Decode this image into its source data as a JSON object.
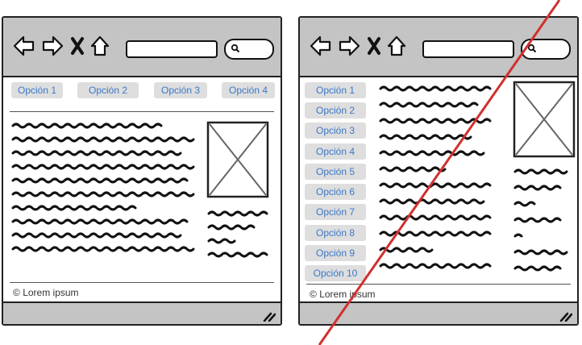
{
  "mockup_a": {
    "tabs": [
      "Opción 1",
      "Opción 2",
      "Opción 3",
      "Opción 4"
    ],
    "footer": "Lorem ipsum",
    "copyright_symbol": "©"
  },
  "mockup_b": {
    "sidebar_items": [
      "Opción 1",
      "Opción 2",
      "Opción 3",
      "Opción 4",
      "Opción 5",
      "Opción 6",
      "Opción 7",
      "Opción 8",
      "Opción 9",
      "Opción 10"
    ],
    "footer": "Lorem ipsum",
    "copyright_symbol": "©",
    "crossed_out": true
  },
  "colors": {
    "toolbar": "#c4c4c4",
    "tab_bg": "#dedede",
    "link": "#3a78c8",
    "strike": "#d03030"
  },
  "icons": [
    "back-arrow-icon",
    "forward-arrow-icon",
    "close-icon",
    "home-icon",
    "search-icon",
    "image-placeholder-icon",
    "resize-grip-icon"
  ]
}
